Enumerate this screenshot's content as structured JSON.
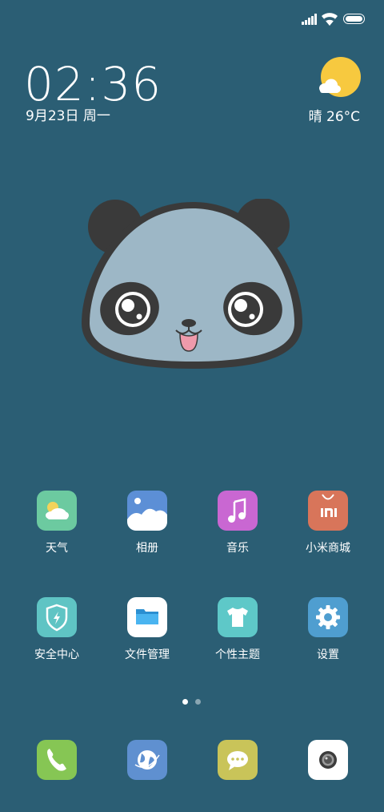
{
  "lockclock": {
    "time": "02:36",
    "date": "9月23日 周一"
  },
  "weather": {
    "text": "晴  26°C",
    "icon": "sun-cloud-icon"
  },
  "apps": [
    {
      "label": "天气",
      "icon": "weather-icon",
      "color": "#6ccaa0"
    },
    {
      "label": "相册",
      "icon": "gallery-icon",
      "color": "#5c8fd6"
    },
    {
      "label": "音乐",
      "icon": "music-icon",
      "color": "#c967d2"
    },
    {
      "label": "小米商城",
      "icon": "mi-store-icon",
      "color": "#d8755a"
    },
    {
      "label": "安全中心",
      "icon": "security-shield-icon",
      "color": "#5fc4c4"
    },
    {
      "label": "文件管理",
      "icon": "folder-icon",
      "color": "#ffffff"
    },
    {
      "label": "个性主题",
      "icon": "tshirt-icon",
      "color": "#5ec8c8"
    },
    {
      "label": "设置",
      "icon": "gear-icon",
      "color": "#4f9ed0"
    }
  ],
  "dock": [
    {
      "icon": "phone-icon",
      "color": "#86c654"
    },
    {
      "icon": "browser-icon",
      "color": "#5f90d0"
    },
    {
      "icon": "messages-icon",
      "color": "#c9c459"
    },
    {
      "icon": "camera-icon",
      "color": "#ffffff"
    }
  ],
  "page_indicator": {
    "current": 1,
    "total": 2
  }
}
